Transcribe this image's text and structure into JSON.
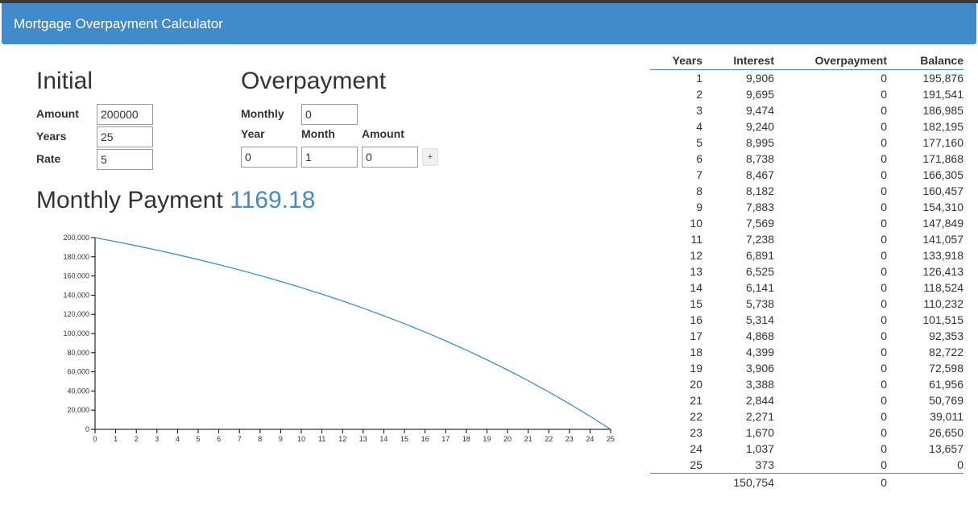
{
  "app": {
    "title": "Mortgage Overpayment Calculator"
  },
  "initial": {
    "heading": "Initial",
    "amount_label": "Amount",
    "amount_value": "200000",
    "years_label": "Years",
    "years_value": "25",
    "rate_label": "Rate",
    "rate_value": "5"
  },
  "overpayment": {
    "heading": "Overpayment",
    "monthly_label": "Monthly",
    "monthly_value": "0",
    "year_label": "Year",
    "month_label": "Month",
    "amount_label": "Amount",
    "year_value": "0",
    "month_value": "1",
    "amount_value": "0",
    "add_label": "+"
  },
  "monthly_payment": {
    "label": "Monthly Payment",
    "value": "1169.18"
  },
  "colors": {
    "accent": "#428bca",
    "line": "#3b8fd0"
  },
  "chart_data": {
    "type": "line",
    "x": [
      0,
      1,
      2,
      3,
      4,
      5,
      6,
      7,
      8,
      9,
      10,
      11,
      12,
      13,
      14,
      15,
      16,
      17,
      18,
      19,
      20,
      21,
      22,
      23,
      24,
      25
    ],
    "series": [
      {
        "values": [
          200000,
          195876,
          191541,
          186985,
          182195,
          177160,
          171868,
          166305,
          160457,
          154310,
          147849,
          141057,
          133918,
          126413,
          118524,
          110232,
          101515,
          92353,
          82722,
          72598,
          61956,
          50769,
          39011,
          26650,
          13657,
          0
        ]
      }
    ],
    "x_ticks": [
      "0",
      "1",
      "2",
      "3",
      "4",
      "5",
      "6",
      "7",
      "8",
      "9",
      "10",
      "11",
      "12",
      "13",
      "14",
      "15",
      "16",
      "17",
      "18",
      "19",
      "20",
      "21",
      "22",
      "23",
      "24",
      "25"
    ],
    "y_ticks": [
      "0",
      "20,000",
      "40,000",
      "60,000",
      "80,000",
      "100,000",
      "120,000",
      "140,000",
      "160,000",
      "180,000",
      "200,000"
    ],
    "xlim": [
      0,
      25
    ],
    "ylim": [
      0,
      200000
    ],
    "grid": false,
    "legend": false
  },
  "table": {
    "headers": [
      "Years",
      "Interest",
      "Overpayment",
      "Balance"
    ],
    "rows": [
      [
        "1",
        "9,906",
        "0",
        "195,876"
      ],
      [
        "2",
        "9,695",
        "0",
        "191,541"
      ],
      [
        "3",
        "9,474",
        "0",
        "186,985"
      ],
      [
        "4",
        "9,240",
        "0",
        "182,195"
      ],
      [
        "5",
        "8,995",
        "0",
        "177,160"
      ],
      [
        "6",
        "8,738",
        "0",
        "171,868"
      ],
      [
        "7",
        "8,467",
        "0",
        "166,305"
      ],
      [
        "8",
        "8,182",
        "0",
        "160,457"
      ],
      [
        "9",
        "7,883",
        "0",
        "154,310"
      ],
      [
        "10",
        "7,569",
        "0",
        "147,849"
      ],
      [
        "11",
        "7,238",
        "0",
        "141,057"
      ],
      [
        "12",
        "6,891",
        "0",
        "133,918"
      ],
      [
        "13",
        "6,525",
        "0",
        "126,413"
      ],
      [
        "14",
        "6,141",
        "0",
        "118,524"
      ],
      [
        "15",
        "5,738",
        "0",
        "110,232"
      ],
      [
        "16",
        "5,314",
        "0",
        "101,515"
      ],
      [
        "17",
        "4,868",
        "0",
        "92,353"
      ],
      [
        "18",
        "4,399",
        "0",
        "82,722"
      ],
      [
        "19",
        "3,906",
        "0",
        "72,598"
      ],
      [
        "20",
        "3,388",
        "0",
        "61,956"
      ],
      [
        "21",
        "2,844",
        "0",
        "50,769"
      ],
      [
        "22",
        "2,271",
        "0",
        "39,011"
      ],
      [
        "23",
        "1,670",
        "0",
        "26,650"
      ],
      [
        "24",
        "1,037",
        "0",
        "13,657"
      ],
      [
        "25",
        "373",
        "0",
        "0"
      ]
    ],
    "totals": {
      "interest": "150,754",
      "overpayment": "0"
    }
  }
}
